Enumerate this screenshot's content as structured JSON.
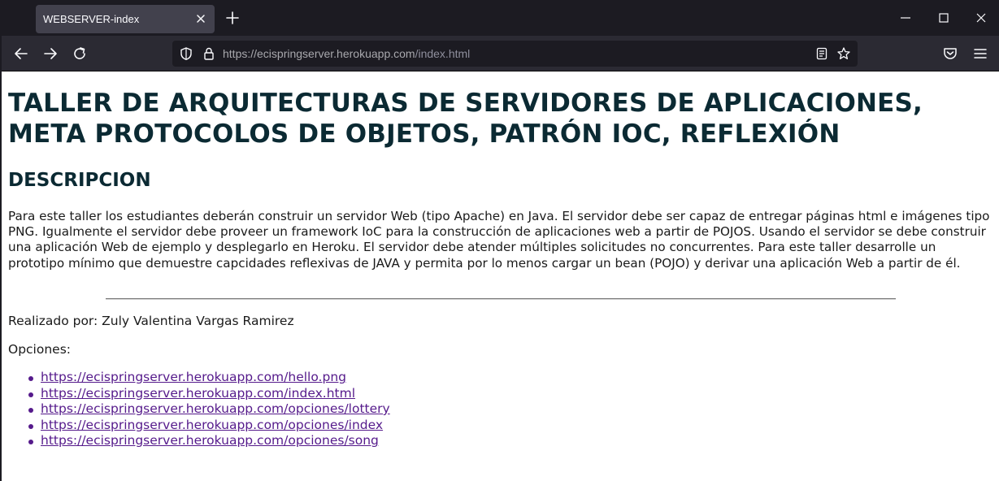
{
  "browser": {
    "tab_title": "WEBSERVER-index",
    "url_host": "https://ecispringserver.herokuapp.com",
    "url_path": "/index.html"
  },
  "page": {
    "title_line1": "TALLER DE ARQUITECTURAS DE SERVIDORES DE APLICACIONES,",
    "title_line2": "META PROTOCOLOS DE OBJETOS, PATRÓN IOC, REFLEXIÓN",
    "section_heading": "DESCRIPCION",
    "description": "Para este taller los estudiantes deberán construir un servidor Web (tipo Apache) en Java. El servidor debe ser capaz de entregar páginas html e imágenes tipo PNG. Igualmente el servidor debe proveer un framework IoC para la construcción de aplicaciones web a partir de POJOS. Usando el servidor se debe construir una aplicación Web de ejemplo y desplegarlo en Heroku. El servidor debe atender múltiples solicitudes no concurrentes. Para este taller desarrolle un prototipo mínimo que demuestre capcidades reflexivas de JAVA y permita por lo menos cargar un bean (POJO) y derivar una aplicación Web a partir de él.",
    "author": "Realizado por: Zuly Valentina Vargas Ramirez",
    "options_label": "Opciones:",
    "links": [
      "https://ecispringserver.herokuapp.com/hello.png",
      "https://ecispringserver.herokuapp.com/index.html",
      "https://ecispringserver.herokuapp.com/opciones/lottery",
      "https://ecispringserver.herokuapp.com/opciones/index",
      "https://ecispringserver.herokuapp.com/opciones/song"
    ]
  },
  "colors": {
    "heading": "#0b2a33",
    "link": "#551a8b",
    "chrome_dark": "#1c1b22",
    "chrome_toolbar": "#2b2a33"
  }
}
